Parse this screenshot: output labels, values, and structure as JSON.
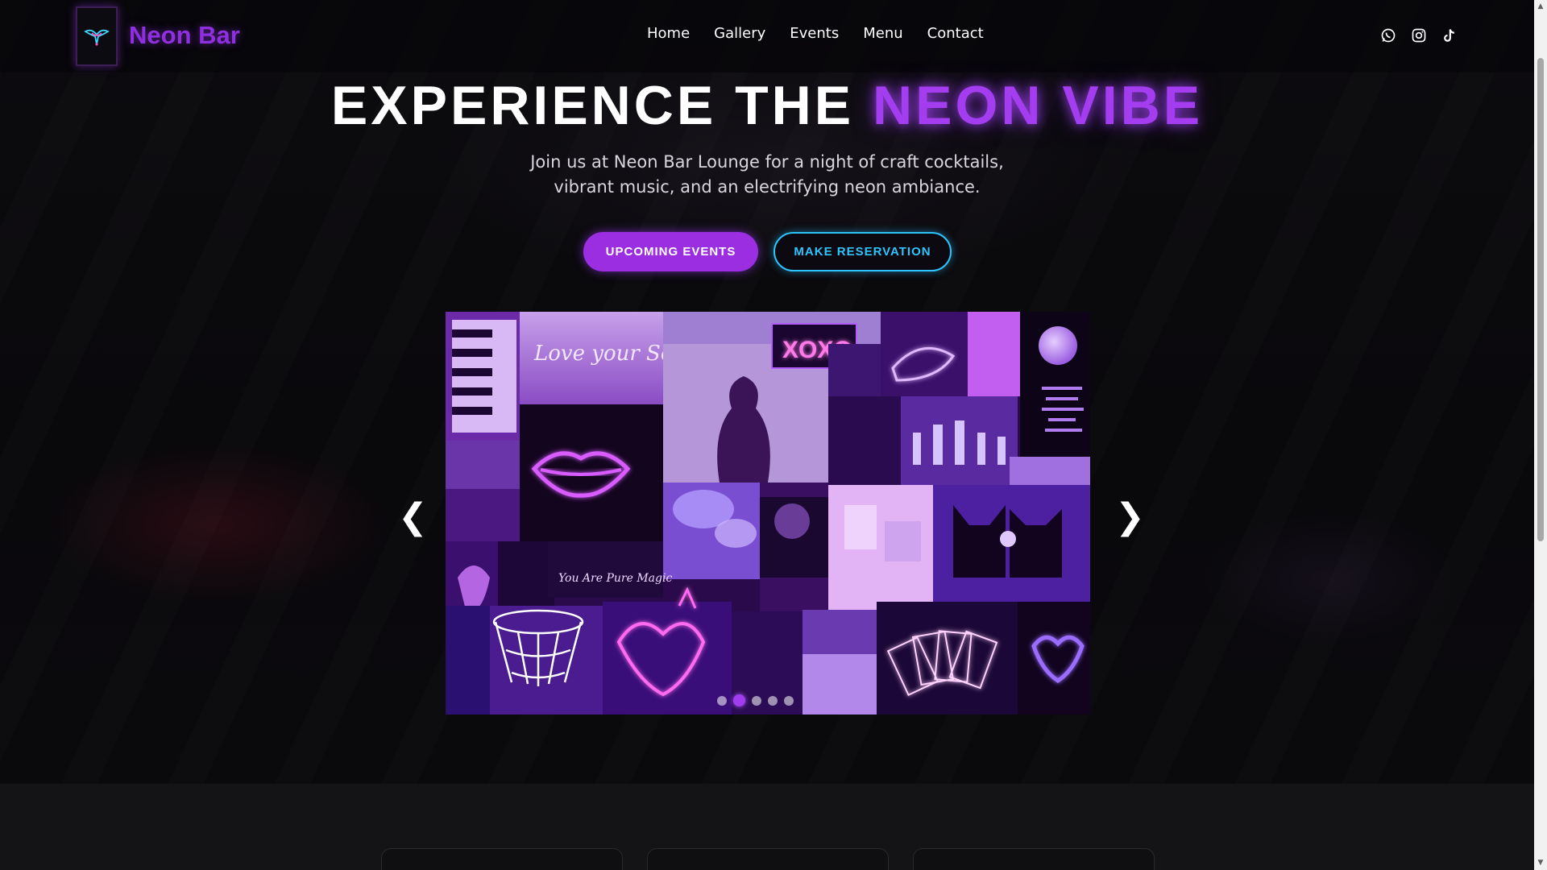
{
  "header": {
    "brand": "Neon Bar",
    "logo_icon": "neon-bird-logo-icon",
    "nav": [
      {
        "label": "Home"
      },
      {
        "label": "Gallery"
      },
      {
        "label": "Events"
      },
      {
        "label": "Menu"
      },
      {
        "label": "Contact"
      }
    ],
    "socials": [
      "whatsapp-icon",
      "instagram-icon",
      "tiktok-icon"
    ]
  },
  "hero": {
    "title_main": "EXPERIENCE THE ",
    "title_accent": "NEON VIBE",
    "subtitle": "Join us at Neon Bar Lounge for a night of craft cocktails, vibrant music, and an electrifying neon ambiance.",
    "primary_button": "UPCOMING EVENTS",
    "secondary_button": "MAKE RESERVATION"
  },
  "carousel": {
    "prev_label": "❮",
    "next_label": "❯",
    "slide_count": 5,
    "active_index": 1,
    "collage_text": {
      "love_yourself": "Love your Self",
      "xoxo": "XOXO",
      "pure_magic": "You Are Pure Magic"
    }
  },
  "colors": {
    "accent_purple": "#9b2ee0",
    "accent_cyan": "#2ec5ff",
    "background": "#0b0a0d"
  }
}
